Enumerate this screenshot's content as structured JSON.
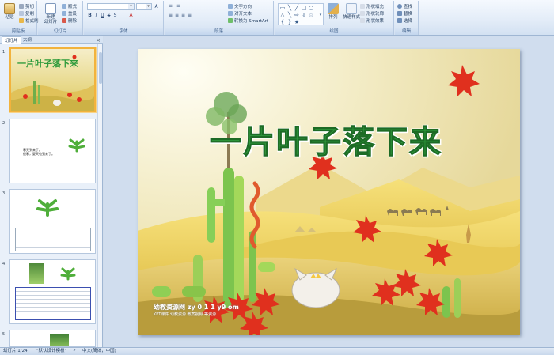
{
  "ribbon": {
    "clipboard": {
      "label": "剪贴板",
      "paste": "粘贴",
      "cut": "剪切",
      "copy": "复制",
      "format_painter": "格式刷"
    },
    "slides": {
      "label": "幻灯片",
      "new_slide": "新建\n幻灯片",
      "layout": "版式",
      "reset": "重设",
      "delete": "删除"
    },
    "font": {
      "label": "字体"
    },
    "paragraph": {
      "label": "段落",
      "text_direction": "文字方向",
      "align_text": "对齐文本",
      "convert_smartart": "转换为 SmartArt"
    },
    "drawing": {
      "label": "绘图",
      "arrange": "排列",
      "quick_styles": "快速样式",
      "shape_fill": "形状填充",
      "shape_outline": "形状轮廓",
      "shape_effects": "形状效果"
    },
    "editing": {
      "label": "编辑",
      "find": "查找",
      "replace": "替换",
      "select": "选择"
    }
  },
  "left_pane": {
    "tab_slides": "幻灯片",
    "tab_outline": "大纲",
    "close": "×",
    "thumbs": [
      {
        "num": "1",
        "title": "一片叶子落下来"
      },
      {
        "num": "2",
        "text": "春天到来了。\n  很春，夏天也到来了。"
      },
      {
        "num": "3",
        "text": ""
      },
      {
        "num": "4",
        "text": ""
      },
      {
        "num": "5",
        "text": ""
      }
    ]
  },
  "slide": {
    "title": "一片叶子落下来",
    "watermark": "幼教资源网 zy 0 1 1 y9 om",
    "watermark_small": "KPT课件 幼教资源 教案视频 等资源"
  },
  "status_bar": {
    "slide_info": "幻灯片 1/24",
    "theme": "\"默认设计模板\"",
    "language": "中文(简体，中国)"
  },
  "colors": {
    "title_green": "#2f9b3c",
    "leaf_red": "#e0301e",
    "selection": "#f2b33d"
  }
}
